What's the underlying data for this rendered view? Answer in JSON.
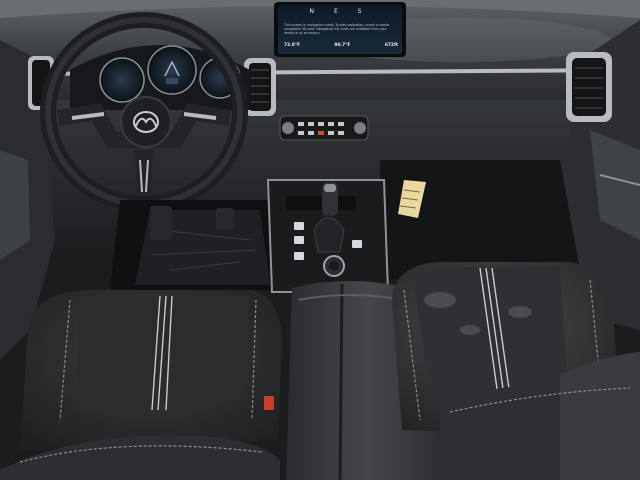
{
  "infotainment": {
    "compass_letters": "N E S",
    "nav_note": "This screen is navigation ready. To add navigation, insert a mazda navigation SD card. Navigation SD cards are available from your dealer or at accessory.",
    "readouts": [
      {
        "label": "Left temp",
        "value": "72.0°F"
      },
      {
        "label": "Ambient",
        "value": "90.7°F"
      },
      {
        "label": "Altitude",
        "value": "672ft"
      }
    ]
  },
  "colors": {
    "dash": "#3a3d41",
    "seat_fabric": "#2b2c2e",
    "stitching": "#c9ccd0",
    "trim_silver": "#b8bcc2",
    "tag_yellow": "#e9d9a0",
    "seat_tag_red": "#c8402c"
  },
  "icons": [
    "mazda-logo-icon",
    "steering-wheel-icon",
    "gear-shifter-icon",
    "hvac-knob-icon"
  ]
}
